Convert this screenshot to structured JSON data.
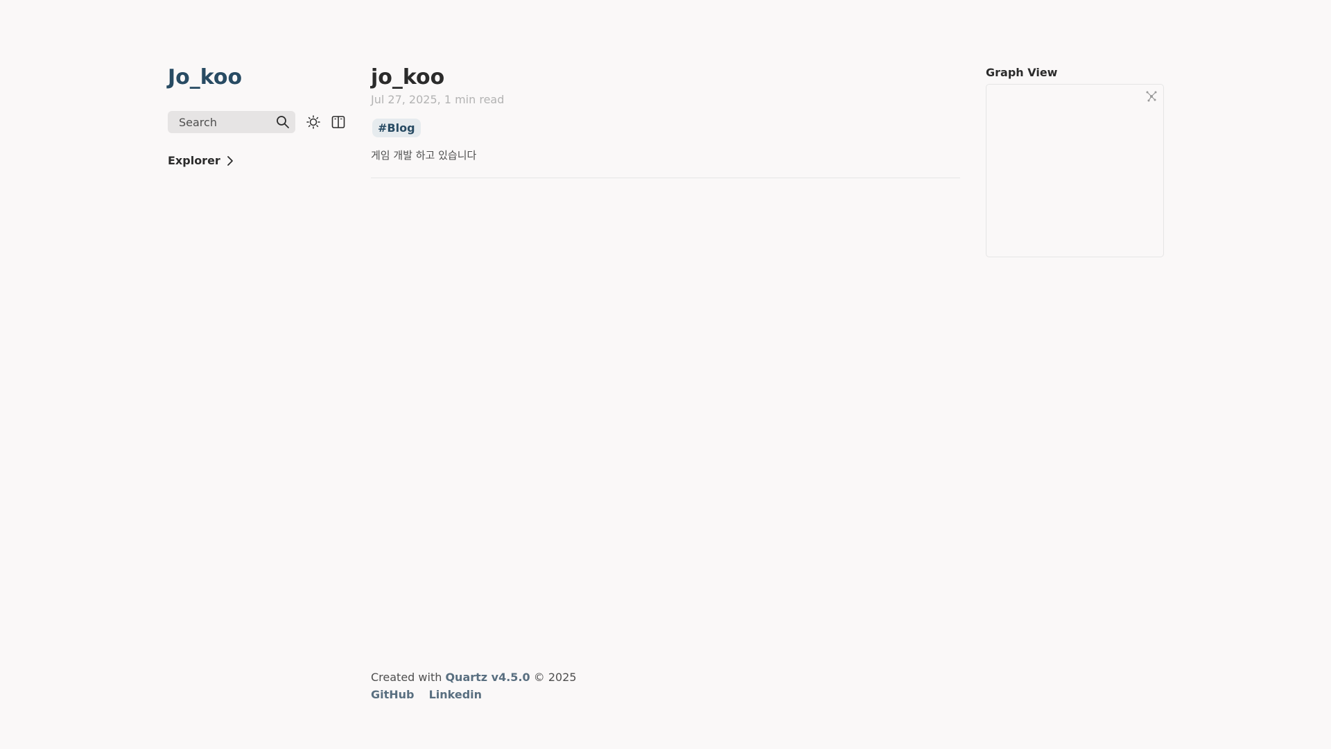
{
  "sidebar": {
    "site_title": "Jo_koo",
    "search_label": "Search",
    "explorer_label": "Explorer",
    "icons": [
      "search-icon",
      "sun-icon",
      "reader-mode-icon",
      "chevron-right-icon"
    ]
  },
  "article": {
    "title": "jo_koo",
    "date": "Jul 27, 2025",
    "reading_time": "1 min read",
    "tags": [
      "#Blog"
    ],
    "body": "게임 개발 하고 있습니다"
  },
  "graph": {
    "title": "Graph View",
    "icon": "expand-graph-icon"
  },
  "footer": {
    "created_with": "Created with",
    "quartz_link": "Quartz v4.5.0",
    "copyright": "© 2025",
    "links": [
      "GitHub",
      "Linkedin"
    ]
  },
  "colors": {
    "background": "#faf8f8",
    "accent": "#284b63",
    "link": "#596f80"
  }
}
